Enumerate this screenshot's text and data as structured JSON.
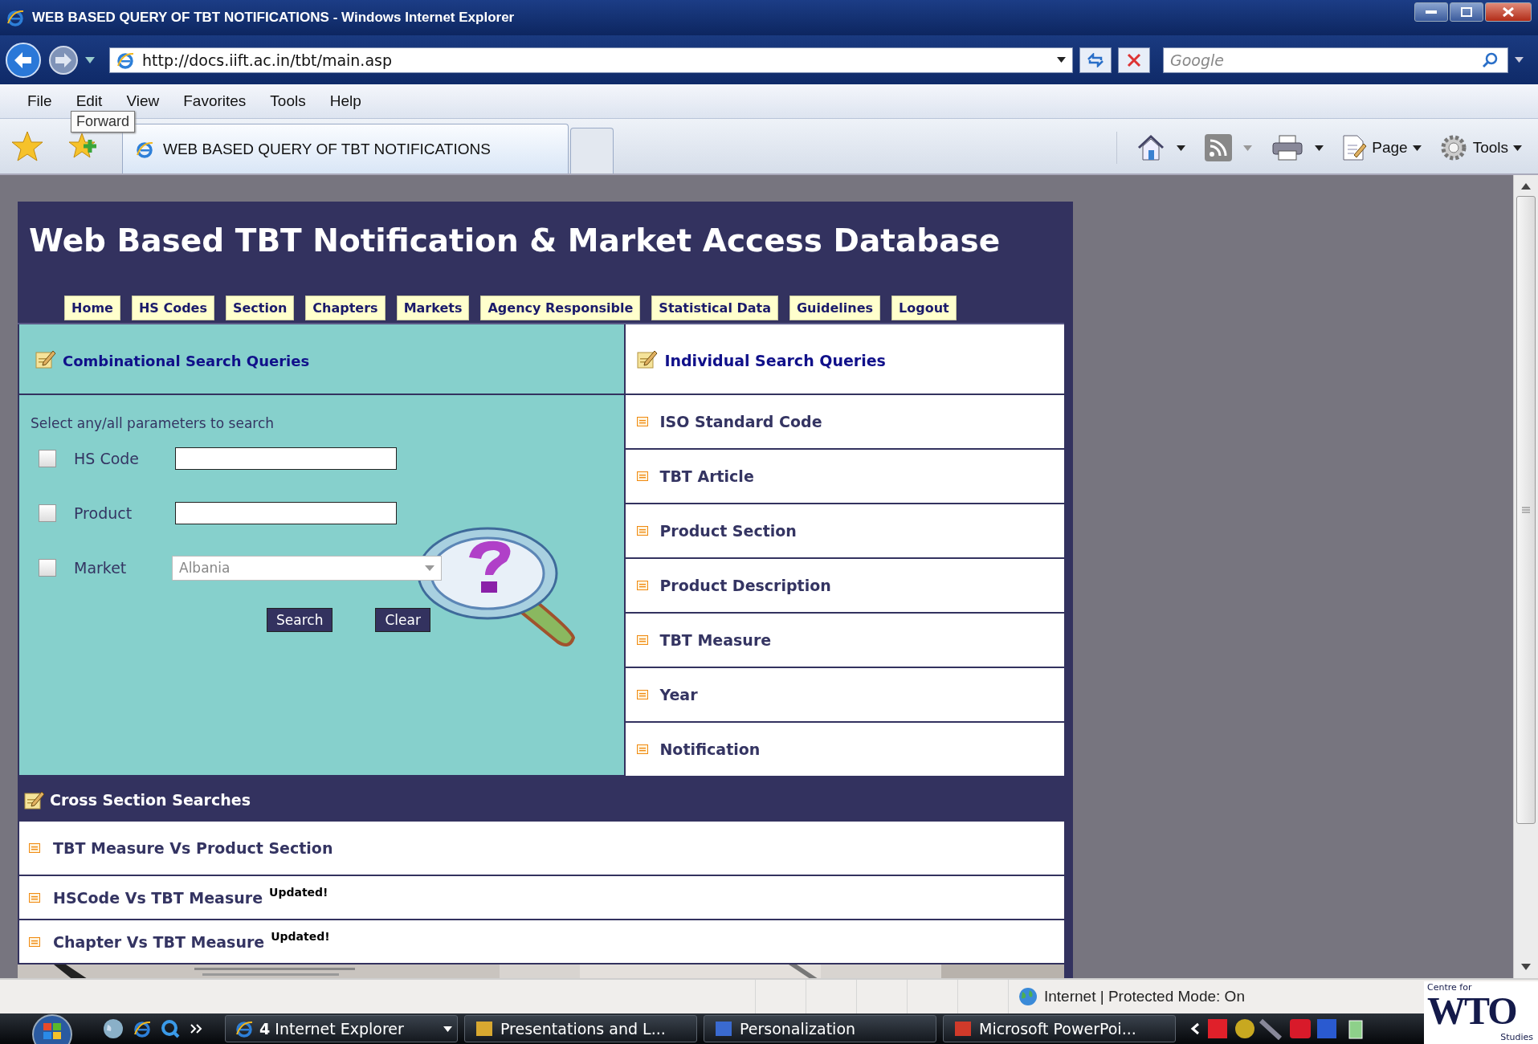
{
  "window": {
    "title": "WEB BASED QUERY OF TBT NOTIFICATIONS - Windows Internet Explorer"
  },
  "address_bar": {
    "url": "http://docs.iift.ac.in/tbt/main.asp"
  },
  "search_box": {
    "placeholder": "Google"
  },
  "menu": [
    "File",
    "Edit",
    "View",
    "Favorites",
    "Tools",
    "Help"
  ],
  "tooltip": "Forward",
  "tabs": [
    {
      "label": "WEB BASED QUERY OF TBT NOTIFICATIONS",
      "selected": true
    }
  ],
  "command_buttons": [
    "Page",
    "Tools"
  ],
  "page": {
    "title": "Web Based TBT Notification & Market Access Database",
    "nav": [
      "Home",
      "HS Codes",
      "Section",
      "Chapters",
      "Markets",
      "Agency Responsible",
      "Statistical Data",
      "Guidelines",
      "Logout"
    ],
    "combinational": {
      "heading": "Combinational Search Queries",
      "instruction": "Select any/all parameters to search",
      "fields": [
        {
          "kind": "text",
          "label": "HS Code",
          "checked": false
        },
        {
          "kind": "text",
          "label": "Product",
          "checked": false
        },
        {
          "kind": "select",
          "label": "Market",
          "checked": false,
          "value": "Albania"
        }
      ],
      "buttons": [
        "Search",
        "Clear"
      ]
    },
    "individual": {
      "heading": "Individual Search Queries",
      "items": [
        "ISO Standard Code",
        "TBT Article",
        "Product Section",
        "Product Description",
        "TBT Measure",
        "Year",
        "Notification"
      ]
    },
    "cross_section": {
      "heading": "Cross Section Searches",
      "items": [
        {
          "label": "TBT Measure Vs Product Section"
        },
        {
          "label": "HSCode Vs TBT Measure",
          "badge": "Updated!"
        },
        {
          "label": "Chapter Vs TBT Measure",
          "badge": "Updated!"
        }
      ]
    }
  },
  "status_bar": {
    "zone": "Internet | Protected Mode: On"
  },
  "taskbar": {
    "buttons": [
      "**4** Internet Explorer",
      "Presentations and L...",
      "Personalization",
      "Microsoft PowerPoi..."
    ]
  },
  "logo": {
    "top": "Centre for",
    "main": "WTO",
    "bottom": "Studies"
  }
}
